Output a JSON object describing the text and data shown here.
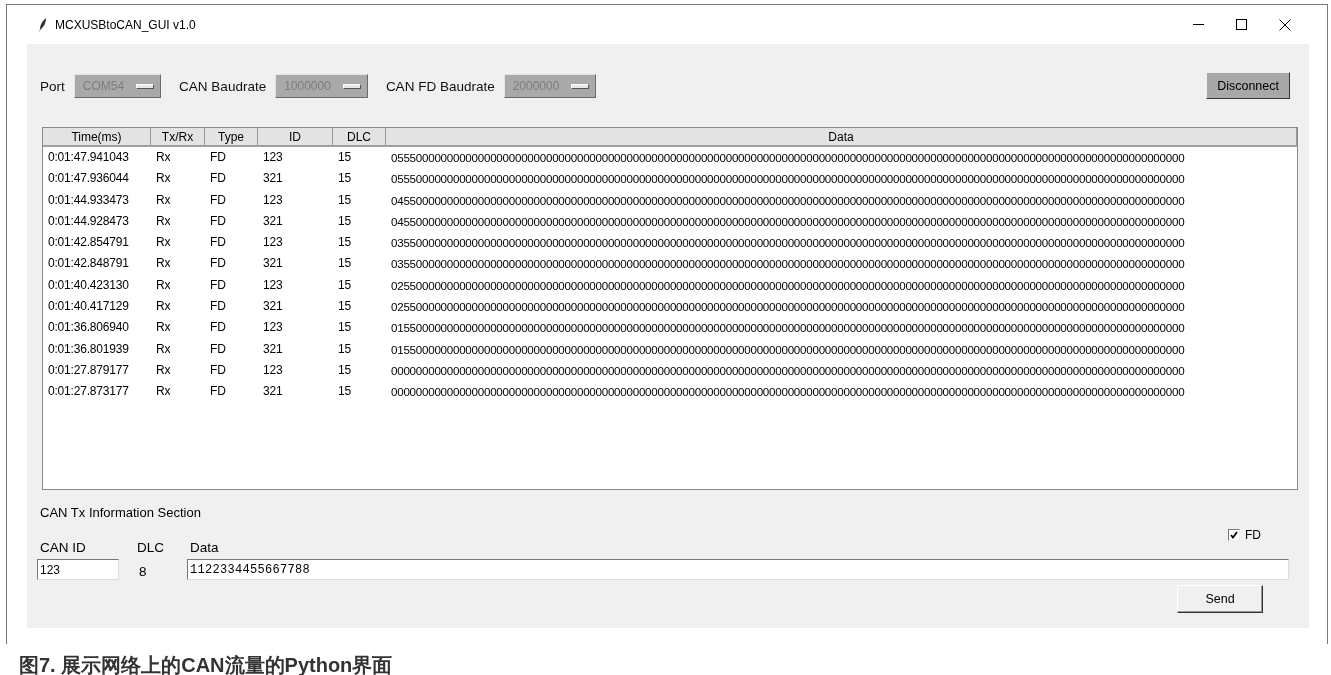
{
  "window": {
    "title": "MCXUSBtoCAN_GUI v1.0"
  },
  "settings": [
    {
      "label": "Port",
      "value": "COM54",
      "disabled": true
    },
    {
      "label": "CAN Baudrate",
      "value": "1000000",
      "disabled": true
    },
    {
      "label": "CAN FD Baudrate",
      "value": "2000000",
      "disabled": true
    }
  ],
  "connect_button": "Disconnect",
  "table": {
    "columns": [
      "Time(ms)",
      "Tx/Rx",
      "Type",
      "ID",
      "DLC",
      "Data"
    ],
    "rows": [
      [
        "0:01:47.941043",
        "Rx",
        "FD",
        "123",
        "15",
        "05550000000000000000000000000000000000000000000000000000000000000000000000000000000000000000000000000000000000000000000000000000"
      ],
      [
        "0:01:47.936044",
        "Rx",
        "FD",
        "321",
        "15",
        "05550000000000000000000000000000000000000000000000000000000000000000000000000000000000000000000000000000000000000000000000000000"
      ],
      [
        "0:01:44.933473",
        "Rx",
        "FD",
        "123",
        "15",
        "04550000000000000000000000000000000000000000000000000000000000000000000000000000000000000000000000000000000000000000000000000000"
      ],
      [
        "0:01:44.928473",
        "Rx",
        "FD",
        "321",
        "15",
        "04550000000000000000000000000000000000000000000000000000000000000000000000000000000000000000000000000000000000000000000000000000"
      ],
      [
        "0:01:42.854791",
        "Rx",
        "FD",
        "123",
        "15",
        "03550000000000000000000000000000000000000000000000000000000000000000000000000000000000000000000000000000000000000000000000000000"
      ],
      [
        "0:01:42.848791",
        "Rx",
        "FD",
        "321",
        "15",
        "03550000000000000000000000000000000000000000000000000000000000000000000000000000000000000000000000000000000000000000000000000000"
      ],
      [
        "0:01:40.423130",
        "Rx",
        "FD",
        "123",
        "15",
        "02550000000000000000000000000000000000000000000000000000000000000000000000000000000000000000000000000000000000000000000000000000"
      ],
      [
        "0:01:40.417129",
        "Rx",
        "FD",
        "321",
        "15",
        "02550000000000000000000000000000000000000000000000000000000000000000000000000000000000000000000000000000000000000000000000000000"
      ],
      [
        "0:01:36.806940",
        "Rx",
        "FD",
        "123",
        "15",
        "01550000000000000000000000000000000000000000000000000000000000000000000000000000000000000000000000000000000000000000000000000000"
      ],
      [
        "0:01:36.801939",
        "Rx",
        "FD",
        "321",
        "15",
        "01550000000000000000000000000000000000000000000000000000000000000000000000000000000000000000000000000000000000000000000000000000"
      ],
      [
        "0:01:27.879177",
        "Rx",
        "FD",
        "123",
        "15",
        "00000000000000000000000000000000000000000000000000000000000000000000000000000000000000000000000000000000000000000000000000000000"
      ],
      [
        "0:01:27.873177",
        "Rx",
        "FD",
        "321",
        "15",
        "00000000000000000000000000000000000000000000000000000000000000000000000000000000000000000000000000000000000000000000000000000000"
      ]
    ]
  },
  "tx_section": {
    "title": "CAN Tx Information Section",
    "labels": [
      "CAN ID",
      "DLC",
      "Data"
    ],
    "can_id": "123",
    "dlc": "8",
    "data": "1122334455667788",
    "fd": {
      "label": "FD",
      "checked": true
    },
    "send_button": "Send"
  },
  "caption": "图7. 展示网络上的CAN流量的Python界面"
}
